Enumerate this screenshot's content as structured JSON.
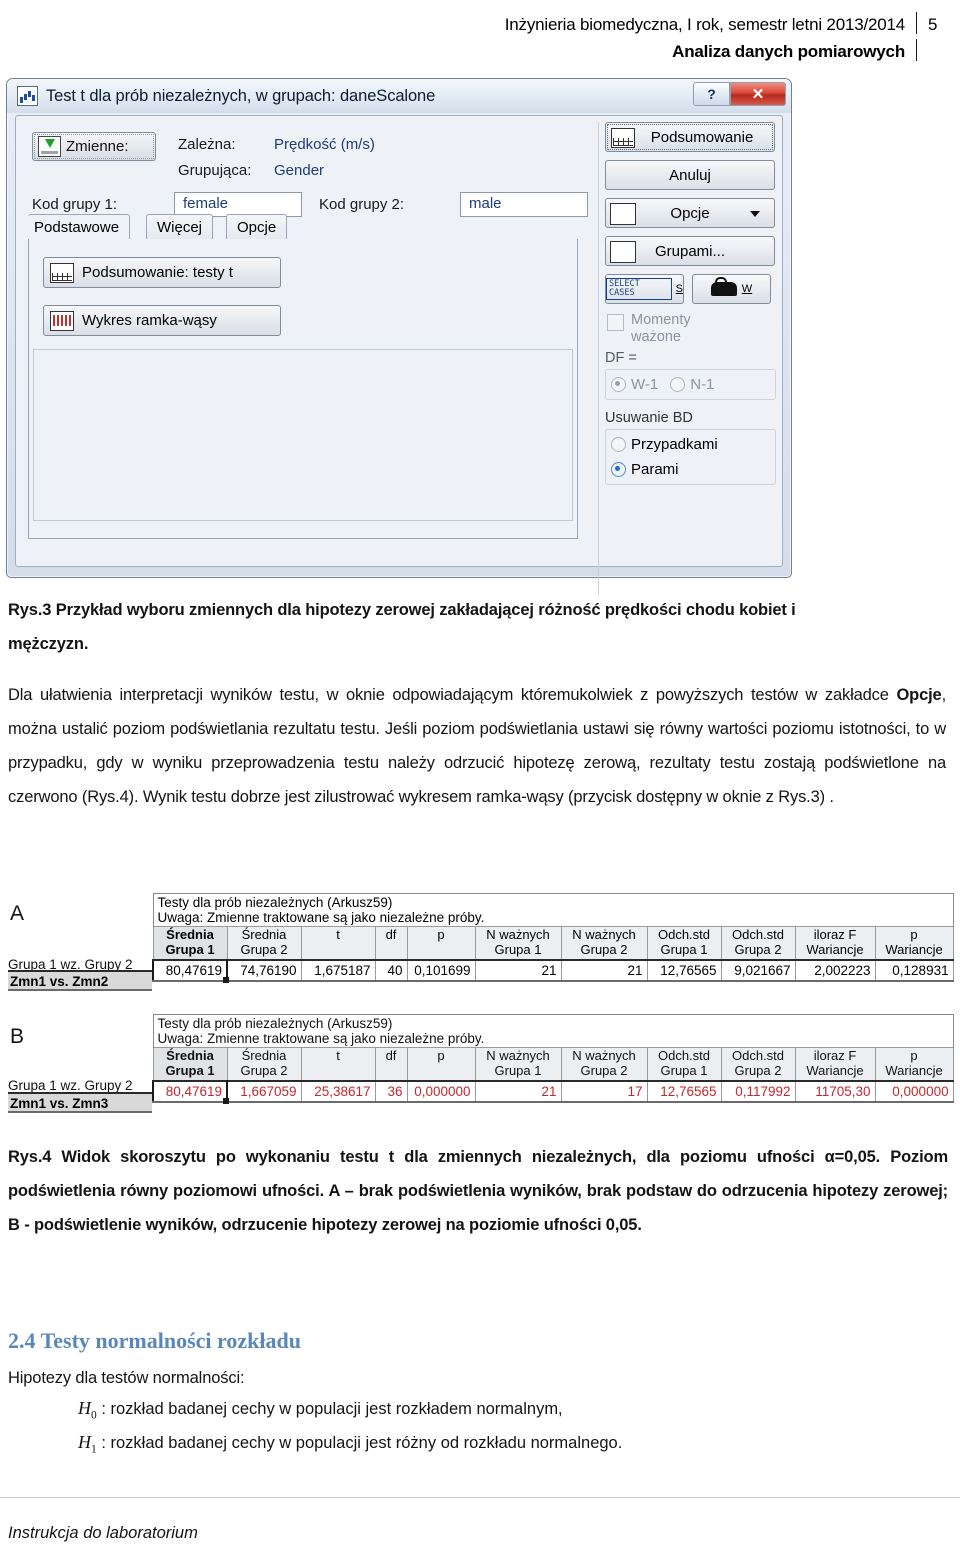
{
  "header": {
    "line1": "Inżynieria biomedyczna, I rok, semestr letni 2013/2014",
    "line2": "Analiza danych pomiarowych",
    "page_number": "5"
  },
  "dialog": {
    "title": "Test t dla prób niezależnych, w grupach: daneScalone",
    "title_icon": "statistica-chart-icon",
    "help_button": "?",
    "close_button": "✕",
    "variables_button": "Zmienne:",
    "variables_button_mnemonic": "Z",
    "dependent_label": "Zależna:",
    "dependent_value": "Prędkość (m/s)",
    "grouping_label": "Grupująca:",
    "grouping_value": "Gender",
    "group1_label": "Kod grupy 1:",
    "group1_value": "female",
    "group2_label": "Kod grupy 2:",
    "group2_value": "male",
    "tabs": [
      {
        "label": "Podstawowe",
        "active": true
      },
      {
        "label": "Więcej",
        "active": false
      },
      {
        "label": "Opcje",
        "active": false
      }
    ],
    "tab_buttons": [
      {
        "label": "Podsumowanie: testy t",
        "icon": "summary-table-icon"
      },
      {
        "label": "Wykres ramka-wąsy",
        "icon": "box-whisker-icon"
      }
    ],
    "right_buttons": [
      {
        "label": "Podsumowanie",
        "icon": "summary-table-icon",
        "focused": true
      },
      {
        "label": "Anuluj",
        "icon": null,
        "focused": false
      },
      {
        "label": "Opcje",
        "icon": "options-wrench-icon",
        "caret": true,
        "focused": false
      },
      {
        "label": "Grupami...",
        "icon": "by-group-icon",
        "focused": false
      }
    ],
    "select_cases_label": "SELECT CASES",
    "select_cases_mnemonic": "S",
    "weight_button_mnemonic": "W",
    "weighted_moments_label_l1": "Momenty",
    "weighted_moments_label_l2": "ważone",
    "df_group_title": "DF =",
    "df_options": [
      {
        "label": "W-1",
        "selected": true
      },
      {
        "label": "N-1",
        "selected": false
      }
    ],
    "md_group_title": "Usuwanie BD",
    "md_options": [
      {
        "label": "Przypadkami",
        "selected": false
      },
      {
        "label": "Parami",
        "selected": true
      }
    ]
  },
  "caption3": {
    "line1": "Rys.3 Przykład wyboru zmiennych dla hipotezy zerowej zakładającej różność prędkości chodu kobiet i",
    "line2": "mężczyzn."
  },
  "paragraph1": {
    "seg1": "Dla ułatwienia interpretacji wyników testu, w oknie odpowiadającym któremukolwiek z powyższych testów w zakładce ",
    "bold": "Opcje",
    "seg2": ", można ustalić poziom podświetlania rezultatu testu. Jeśli poziom podświetlania ustawi się równy wartości poziomu istotności, to w przypadku, gdy w wyniku przeprowadzenia testu należy odrzucić hipotezę zerową, rezultaty testu zostają podświetlone na czerwono (Rys.4). Wynik testu dobrze jest zilustrować wykresem ramka-wąsy (przycisk dostępny w oknie z Rys.3) ."
  },
  "tables": {
    "title_line1": "Testy dla prób niezależnych (Arkusz59)",
    "title_line2": "Uwaga: Zmienne traktowane są jako niezależne próby.",
    "group_caption": "Grupa 1  wz. Grupy 2",
    "headers": [
      {
        "l1": "Średnia",
        "l2": "Grupa 1",
        "hl": true
      },
      {
        "l1": "Średnia",
        "l2": "Grupa 2",
        "hl": false
      },
      {
        "l1": "t",
        "l2": "",
        "hl": false
      },
      {
        "l1": "df",
        "l2": "",
        "hl": false
      },
      {
        "l1": "p",
        "l2": "",
        "hl": false
      },
      {
        "l1": "N ważnych",
        "l2": "Grupa 1",
        "hl": false
      },
      {
        "l1": "N ważnych",
        "l2": "Grupa 2",
        "hl": false
      },
      {
        "l1": "Odch.std",
        "l2": "Grupa 1",
        "hl": false
      },
      {
        "l1": "Odch.std",
        "l2": "Grupa 2",
        "hl": false
      },
      {
        "l1": "iloraz F",
        "l2": "Wariancje",
        "hl": false
      },
      {
        "l1": "p",
        "l2": "Wariancje",
        "hl": false
      }
    ],
    "panel_a": {
      "letter": "A",
      "row_label": "Zmn1 vs.      Zmn2",
      "values": [
        "80,47619",
        "74,76190",
        "1,675187",
        "40",
        "0,101699",
        "21",
        "21",
        "12,76565",
        "9,021667",
        "2,002223",
        "0,128931"
      ]
    },
    "panel_b": {
      "letter": "B",
      "row_label": "Zmn1 vs.      Zmn3",
      "values": [
        "80,47619",
        "1,667059",
        "25,38617",
        "36",
        "0,000000",
        "21",
        "17",
        "12,76565",
        "0,117992",
        "11705,30",
        "0,000000"
      ],
      "highlight_color": "#c1272d"
    }
  },
  "caption4": {
    "text": "Rys.4  Widok skoroszytu po wykonaniu testu t dla zmiennych niezależnych, dla poziomu ufności α=0,05. Poziom podświetlenia równy poziomowi ufności. A – brak podświetlenia wyników, brak podstaw do odrzucenia hipotezy zerowej; B - podświetlenie wyników, odrzucenie hipotezy zerowej na poziomie ufności 0,05."
  },
  "section": {
    "heading": "2.4 Testy normalności rozkładu",
    "heading_color": "#5a87b8",
    "intro": "Hipotezy dla testów normalności:",
    "h0_symbol": "H",
    "h0_sub": "0",
    "h0_text": ": rozkład badanej cechy w populacji jest rozkładem normalnym,",
    "h1_symbol": "H",
    "h1_sub": "1",
    "h1_text": ": rozkład badanej cechy w populacji jest różny od rozkładu normalnego."
  },
  "footer": {
    "text": "Instrukcja do laboratorium"
  }
}
